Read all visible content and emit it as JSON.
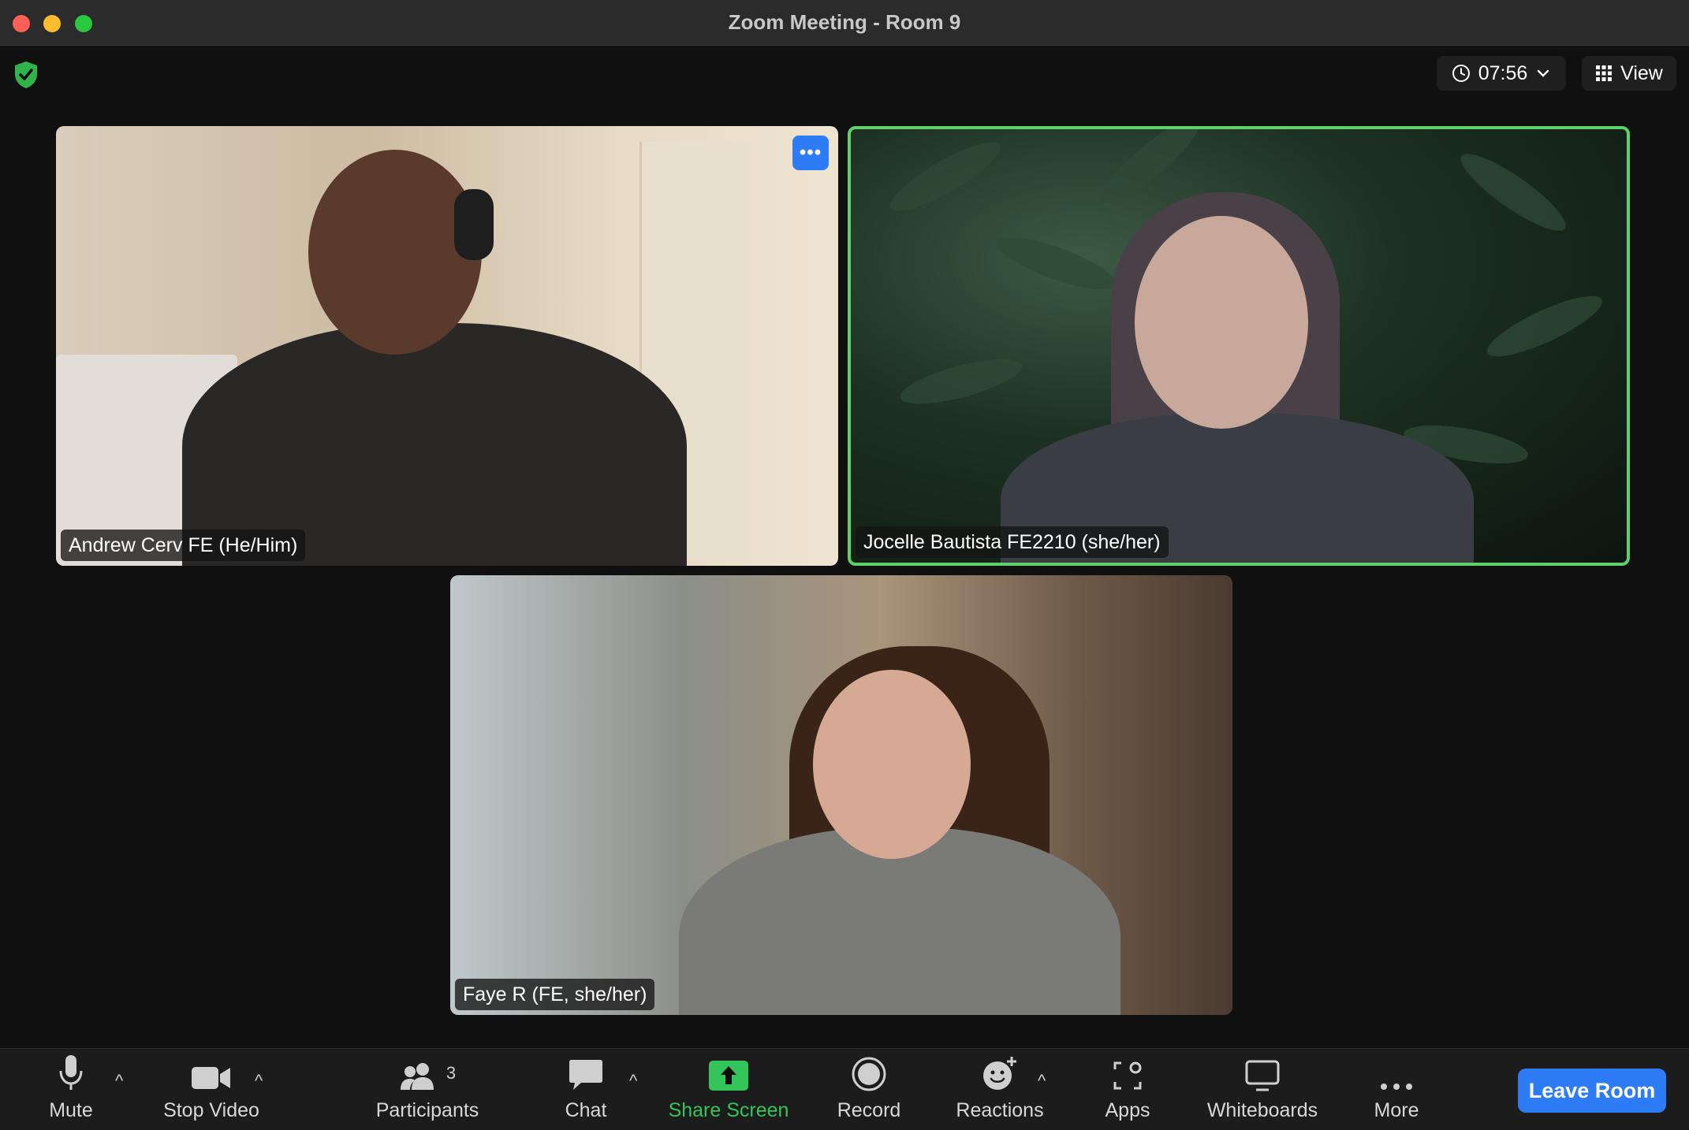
{
  "window": {
    "title": "Zoom Meeting - Room 9"
  },
  "header": {
    "timer": "07:56",
    "view_label": "View"
  },
  "participants": [
    {
      "name": "Andrew Cerv  FE (He/Him)"
    },
    {
      "name": "Jocelle Bautista FE2210 (she/her)"
    },
    {
      "name": "Faye R (FE, she/her)"
    }
  ],
  "toolbar": {
    "mute": "Mute",
    "stop_video": "Stop Video",
    "participants": "Participants",
    "participants_count": "3",
    "chat": "Chat",
    "share_screen": "Share Screen",
    "record": "Record",
    "reactions": "Reactions",
    "apps": "Apps",
    "whiteboards": "Whiteboards",
    "more": "More",
    "leave": "Leave Room"
  },
  "colors": {
    "active_speaker": "#5fd16b",
    "accent": "#2d7cf6",
    "share_green": "#33c45a"
  }
}
